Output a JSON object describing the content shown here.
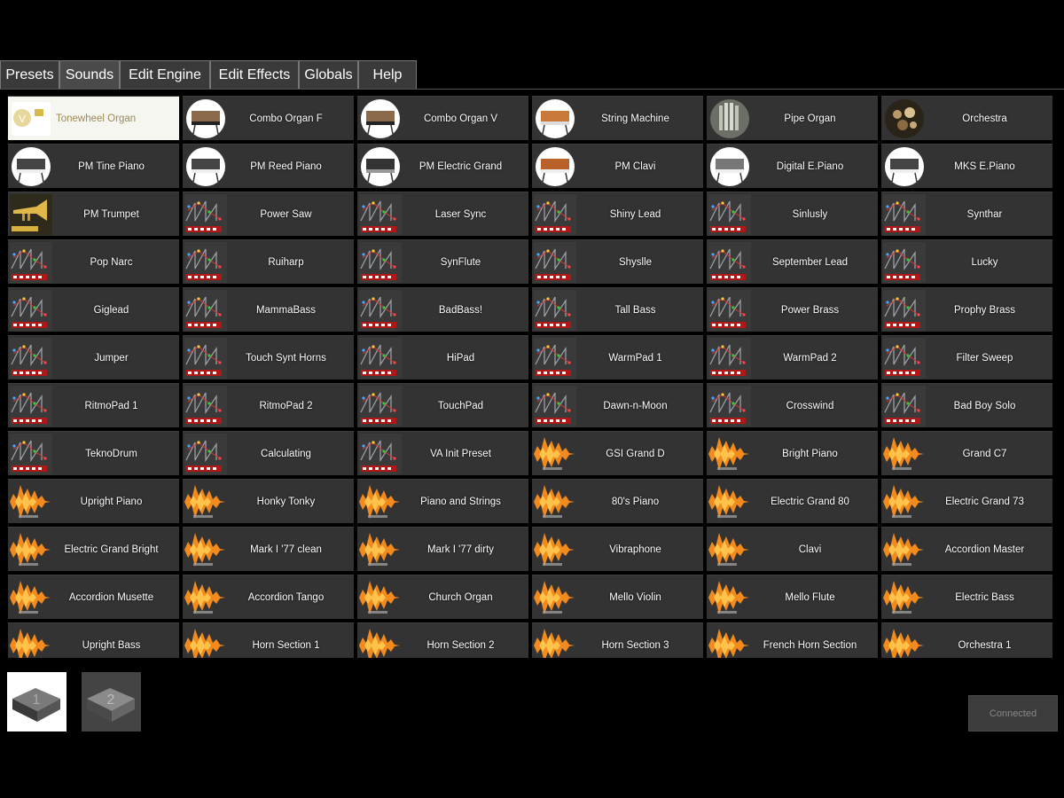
{
  "tabs": [
    {
      "label": "Presets",
      "active": false
    },
    {
      "label": "Sounds",
      "active": true
    },
    {
      "label": "Edit Engine",
      "active": false
    },
    {
      "label": "Edit Effects",
      "active": false
    },
    {
      "label": "Globals",
      "active": false
    },
    {
      "label": "Help",
      "active": false
    }
  ],
  "sounds": [
    {
      "label": "Tonewheel Organ",
      "icon": "tonewheel-organ-icon",
      "selected": true
    },
    {
      "label": "Combo Organ F",
      "icon": "organ-icon"
    },
    {
      "label": "Combo Organ V",
      "icon": "organ-icon"
    },
    {
      "label": "String Machine",
      "icon": "string-machine-icon"
    },
    {
      "label": "Pipe Organ",
      "icon": "pipe-organ-icon"
    },
    {
      "label": "Orchestra",
      "icon": "orchestra-icon"
    },
    {
      "label": "PM Tine Piano",
      "icon": "electric-piano-icon"
    },
    {
      "label": "PM Reed Piano",
      "icon": "electric-piano-icon"
    },
    {
      "label": "PM Electric Grand",
      "icon": "electric-grand-icon"
    },
    {
      "label": "PM Clavi",
      "icon": "clavi-icon"
    },
    {
      "label": "Digital E.Piano",
      "icon": "digital-piano-icon"
    },
    {
      "label": "MKS E.Piano",
      "icon": "electric-piano-icon"
    },
    {
      "label": "PM Trumpet",
      "icon": "trumpet-icon"
    },
    {
      "label": "Power Saw",
      "icon": "va-synth-icon"
    },
    {
      "label": "Laser Sync",
      "icon": "va-synth-icon"
    },
    {
      "label": "Shiny Lead",
      "icon": "va-synth-icon"
    },
    {
      "label": "Sinlusly",
      "icon": "va-synth-icon"
    },
    {
      "label": "Synthar",
      "icon": "va-synth-icon"
    },
    {
      "label": "Pop Narc",
      "icon": "va-synth-icon"
    },
    {
      "label": "Ruiharp",
      "icon": "va-synth-icon"
    },
    {
      "label": "SynFlute",
      "icon": "va-synth-icon"
    },
    {
      "label": "Shyslle",
      "icon": "va-synth-icon"
    },
    {
      "label": "September Lead",
      "icon": "va-synth-icon"
    },
    {
      "label": "Lucky",
      "icon": "va-synth-icon"
    },
    {
      "label": "Giglead",
      "icon": "va-synth-icon"
    },
    {
      "label": "MammaBass",
      "icon": "va-synth-icon"
    },
    {
      "label": "BadBass!",
      "icon": "va-synth-icon"
    },
    {
      "label": "Tall Bass",
      "icon": "va-synth-icon"
    },
    {
      "label": "Power Brass",
      "icon": "va-synth-icon"
    },
    {
      "label": "Prophy Brass",
      "icon": "va-synth-icon"
    },
    {
      "label": "Jumper",
      "icon": "va-synth-icon"
    },
    {
      "label": "Touch Synt Horns",
      "icon": "va-synth-icon"
    },
    {
      "label": "HiPad",
      "icon": "va-synth-icon"
    },
    {
      "label": "WarmPad 1",
      "icon": "va-synth-icon"
    },
    {
      "label": "WarmPad 2",
      "icon": "va-synth-icon"
    },
    {
      "label": "Filter Sweep",
      "icon": "va-synth-icon"
    },
    {
      "label": "RitmoPad 1",
      "icon": "va-synth-icon"
    },
    {
      "label": "RitmoPad 2",
      "icon": "va-synth-icon"
    },
    {
      "label": "TouchPad",
      "icon": "va-synth-icon"
    },
    {
      "label": "Dawn-n-Moon",
      "icon": "va-synth-icon"
    },
    {
      "label": "Crosswind",
      "icon": "va-synth-icon"
    },
    {
      "label": "Bad Boy Solo",
      "icon": "va-synth-icon"
    },
    {
      "label": "TeknoDrum",
      "icon": "va-synth-icon"
    },
    {
      "label": "Calculating",
      "icon": "va-synth-icon"
    },
    {
      "label": "VA Init Preset",
      "icon": "va-synth-icon"
    },
    {
      "label": "GSI Grand D",
      "icon": "sample-wave-icon"
    },
    {
      "label": "Bright Piano",
      "icon": "sample-wave-icon"
    },
    {
      "label": "Grand C7",
      "icon": "sample-wave-icon"
    },
    {
      "label": "Upright Piano",
      "icon": "sample-wave-icon"
    },
    {
      "label": "Honky Tonky",
      "icon": "sample-wave-icon"
    },
    {
      "label": "Piano and Strings",
      "icon": "sample-wave-icon"
    },
    {
      "label": "80's Piano",
      "icon": "sample-wave-icon"
    },
    {
      "label": "Electric Grand 80",
      "icon": "sample-wave-icon"
    },
    {
      "label": "Electric Grand 73",
      "icon": "sample-wave-icon"
    },
    {
      "label": "Electric Grand Bright",
      "icon": "sample-wave-icon"
    },
    {
      "label": "Mark I '77 clean",
      "icon": "sample-wave-icon"
    },
    {
      "label": "Mark I '77 dirty",
      "icon": "sample-wave-icon"
    },
    {
      "label": "Vibraphone",
      "icon": "sample-wave-icon"
    },
    {
      "label": "Clavi",
      "icon": "sample-wave-icon"
    },
    {
      "label": "Accordion Master",
      "icon": "sample-wave-icon"
    },
    {
      "label": "Accordion Musette",
      "icon": "sample-wave-icon"
    },
    {
      "label": "Accordion Tango",
      "icon": "sample-wave-icon"
    },
    {
      "label": "Church Organ",
      "icon": "sample-wave-icon"
    },
    {
      "label": "Mello Violin",
      "icon": "sample-wave-icon"
    },
    {
      "label": "Mello Flute",
      "icon": "sample-wave-icon"
    },
    {
      "label": "Electric Bass",
      "icon": "sample-wave-icon"
    },
    {
      "label": "Upright Bass",
      "icon": "sample-wave-icon"
    },
    {
      "label": "Horn Section 1",
      "icon": "sample-wave-icon"
    },
    {
      "label": "Horn Section 2",
      "icon": "sample-wave-icon"
    },
    {
      "label": "Horn Section 3",
      "icon": "sample-wave-icon"
    },
    {
      "label": "French Horn Section",
      "icon": "sample-wave-icon"
    },
    {
      "label": "Orchestra 1",
      "icon": "sample-wave-icon"
    }
  ],
  "pages": [
    {
      "label": "1",
      "active": true
    },
    {
      "label": "2",
      "active": false
    }
  ],
  "status": {
    "label": "Connected"
  },
  "colors": {
    "cell_bg": "#333333",
    "selected_bg": "#f6f6f1",
    "tab_bg": "#3a3a3a",
    "wave_orange": "#f28a1e"
  }
}
